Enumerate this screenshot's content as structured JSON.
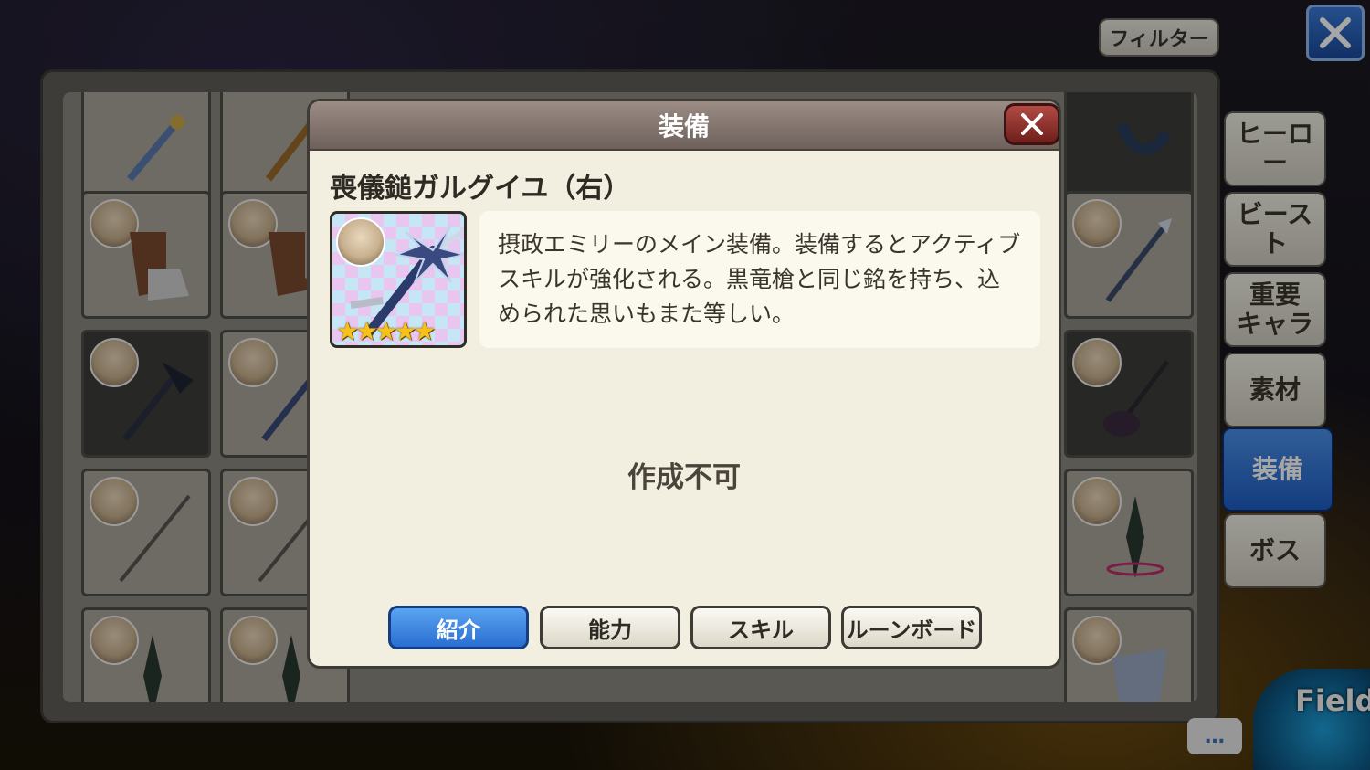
{
  "header": {
    "filter_label": "フィルター"
  },
  "tabs": [
    {
      "label": "ヒーロー",
      "active": false
    },
    {
      "label": "ビースト",
      "active": false
    },
    {
      "label": "重要\nキャラ",
      "active": false
    },
    {
      "label": "素材",
      "active": false
    },
    {
      "label": "装備",
      "active": true
    },
    {
      "label": "ボス",
      "active": false
    }
  ],
  "field_badge": "Field",
  "chat_icon": "…",
  "modal": {
    "title": "装備",
    "item_name": "喪儀鎚ガルグイユ（右）",
    "rarity_stars": "★★★★★",
    "description": "摂政エミリーのメイン装備。装備するとアクティブスキルが強化される。黒竜槍と同じ銘を持ち、込められた思いもまた等しい。",
    "status": "作成不可",
    "buttons": [
      {
        "label": "紹介",
        "active": true
      },
      {
        "label": "能力",
        "active": false
      },
      {
        "label": "スキル",
        "active": false
      },
      {
        "label": "ルーンボード",
        "active": false
      }
    ]
  },
  "colors": {
    "active_blue": "#2a6ed2",
    "header_mauve": "#8a7b75",
    "star_gold": "#f6c21a"
  }
}
